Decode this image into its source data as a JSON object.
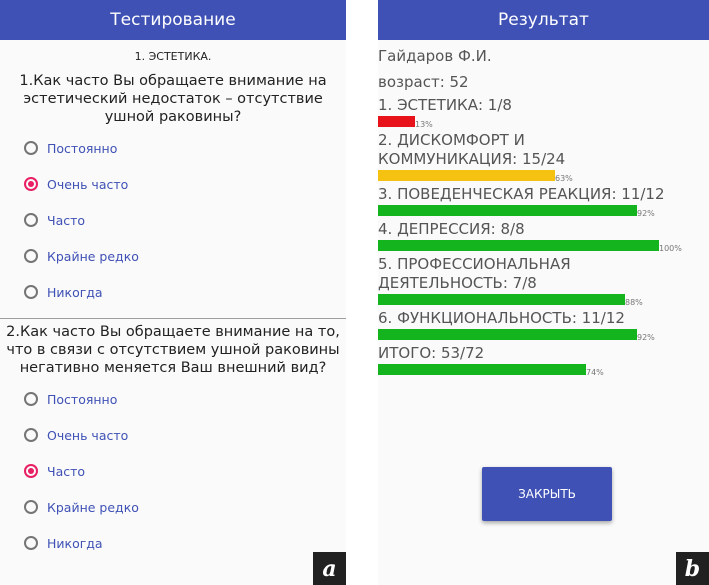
{
  "screen_a": {
    "title": "Тестирование",
    "section": "1. ЭСТЕТИКА.",
    "questions": [
      {
        "text": "1.Как часто Вы обращаете внимание на эстетический недостаток – отсутствие ушной раковины?",
        "options": [
          "Постоянно",
          "Очень часто",
          "Часто",
          "Крайне редко",
          "Никогда"
        ],
        "selected": 1
      },
      {
        "text": "2.Как часто Вы обращаете внимание на то, что в связи с отсутствием ушной раковины негативно меняется Ваш внешний вид?",
        "options": [
          "Постоянно",
          "Очень часто",
          "Часто",
          "Крайне редко",
          "Никогда"
        ],
        "selected": 2
      }
    ],
    "tag": "a"
  },
  "screen_b": {
    "title": "Результат",
    "name": "Гайдаров Ф.И.",
    "age": "возраст: 52",
    "results": [
      {
        "label": "1. ЭСТЕТИКА: 1/8",
        "percent": 13,
        "percent_text": "13%",
        "color": "#e8131a"
      },
      {
        "label": "2. ДИСКОМФОРТ И КОММУНИКАЦИЯ: 15/24",
        "percent": 63,
        "percent_text": "63%",
        "color": "#f5c211"
      },
      {
        "label": "3. ПОВЕДЕНЧЕСКАЯ РЕАКЦИЯ: 11/12",
        "percent": 92,
        "percent_text": "92%",
        "color": "#14b41e"
      },
      {
        "label": "4. ДЕПРЕССИЯ: 8/8",
        "percent": 100,
        "percent_text": "100%",
        "color": "#14b41e"
      },
      {
        "label": "5. ПРОФЕССИОНАЛЬНАЯ ДЕЯТЕЛЬНОСТЬ: 7/8",
        "percent": 88,
        "percent_text": "88%",
        "color": "#14b41e"
      },
      {
        "label": "6. ФУНКЦИОНАЛЬНОСТЬ: 11/12",
        "percent": 92,
        "percent_text": "92%",
        "color": "#14b41e"
      },
      {
        "label": "ИТОГО: 53/72",
        "percent": 74,
        "percent_text": "74%",
        "color": "#14b41e"
      }
    ],
    "close_label": "ЗАКРЫТЬ",
    "tag": "b"
  },
  "colors": {
    "appbar": "#3f51b5",
    "accent": "#e91e63",
    "option_text": "#3f51b5"
  }
}
